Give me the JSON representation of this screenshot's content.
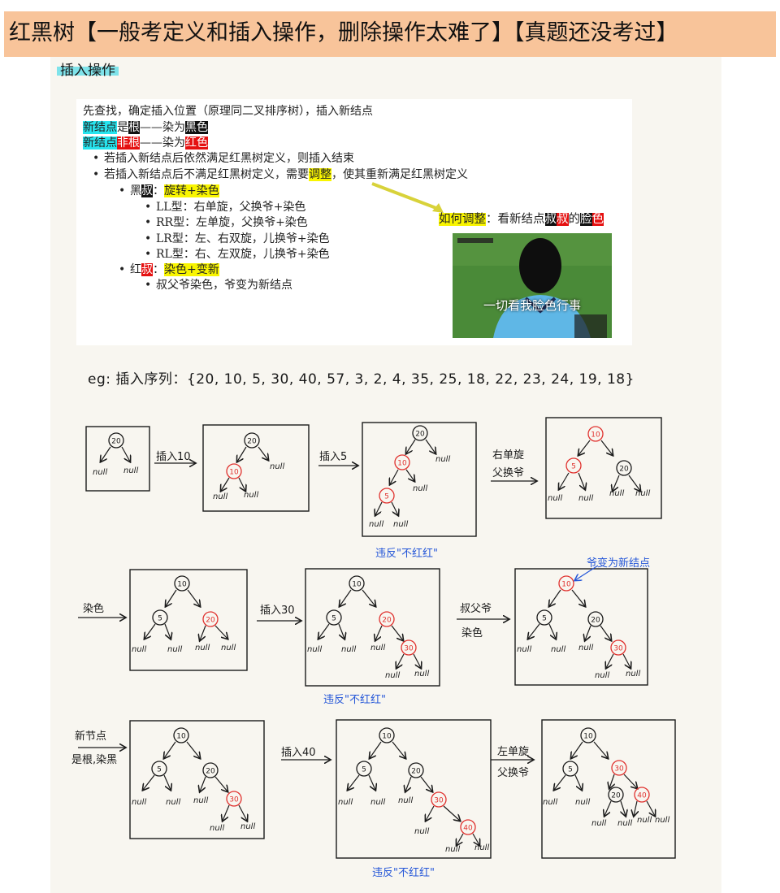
{
  "title": "红黑树【一般考定义和插入操作，删除操作太难了】【真题还没考过】",
  "section_title": "插入操作",
  "rules": {
    "line1": "先查找，确定插入位置（原理同二叉排序树），插入新结点",
    "line2": {
      "a": "新结点",
      "b": "是",
      "c": "根",
      "d": "——染为",
      "e": "黑色"
    },
    "line3": {
      "a": "新结点",
      "b": "非根",
      "c": "——染为",
      "d": "红色"
    },
    "bullet1": "若插入新结点后依然满足红黑树定义，则插入结束",
    "bullet2": {
      "a": "若插入新结点后不满足红黑树定义，需要",
      "b": "调整",
      "c": "，使其重新满足红黑树定义"
    },
    "black_uncle": {
      "a": "黑",
      "b": "叔",
      "c": "：",
      "d": "旋转+染色"
    },
    "ll": "LL型：右单旋，父换爷+染色",
    "rr": "RR型：左单旋，父换爷+染色",
    "lr": "LR型：左、右双旋，儿换爷+染色",
    "rl": "RL型：右、左双旋，儿换爷+染色",
    "red_uncle": {
      "a": "红",
      "b": "叔",
      "c": "：",
      "d": "染色+变新"
    },
    "red_rule": "叔父爷染色，爷变为新结点",
    "how": {
      "a": "如何调整",
      "b": "：看新结点",
      "c": "叔",
      "d": "叔",
      "e": "的",
      "f": "脸",
      "g": "色"
    },
    "meme_caption": "一切看我脸色行事"
  },
  "example": "eg: 插入序列：{20, 10, 5, 30, 40, 57, 3, 2, 4, 35, 25, 18, 22, 23, 24, 19, 18}",
  "labels": {
    "insert10": "插入10",
    "insert5": "插入5",
    "rotate_right": "右单旋",
    "father_swap": "父换爷",
    "dye": "染色",
    "insert30": "插入30",
    "uncle_dye_1": "叔父爷",
    "uncle_dye_2": "染色",
    "newnode_1": "新节点",
    "newnode_2": "是根,染黑",
    "insert40": "插入40",
    "rotate_left": "左单旋",
    "father_swap2": "父换爷",
    "violate": "违反\"不红红\"",
    "grandpa_new": "爷变为新结点"
  },
  "colors": {
    "red_node": "#e0322f",
    "black_node": "#1a1a1a",
    "note_blue": "#2456d8"
  },
  "null": "null"
}
